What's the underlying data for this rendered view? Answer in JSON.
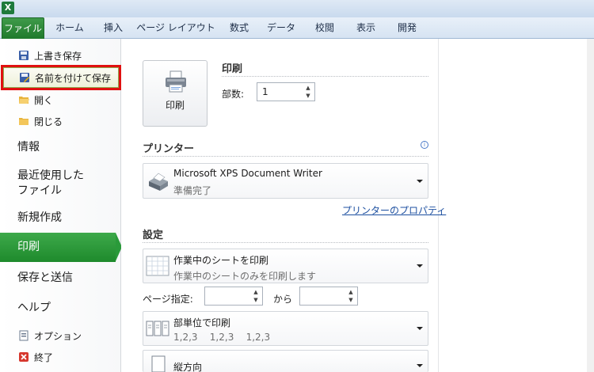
{
  "titlebar": {
    "app_icon": "excel-icon"
  },
  "ribbon": {
    "tabs": [
      {
        "label": "ファイル"
      },
      {
        "label": "ホーム"
      },
      {
        "label": "挿入"
      },
      {
        "label": "ページ レイアウト"
      },
      {
        "label": "数式"
      },
      {
        "label": "データ"
      },
      {
        "label": "校閲"
      },
      {
        "label": "表示"
      },
      {
        "label": "開発"
      }
    ]
  },
  "backstage": {
    "commands": [
      {
        "label": "上書き保存",
        "icon": "save-icon"
      },
      {
        "label": "名前を付けて保存",
        "icon": "save-as-icon"
      },
      {
        "label": "開く",
        "icon": "open-folder-icon"
      },
      {
        "label": "閉じる",
        "icon": "close-folder-icon"
      }
    ],
    "sections": [
      {
        "label": "情報"
      },
      {
        "label": "最近使用した\nファイル"
      },
      {
        "label": "新規作成"
      },
      {
        "label": "印刷"
      },
      {
        "label": "保存と送信"
      },
      {
        "label": "ヘルプ"
      }
    ],
    "bottom": [
      {
        "label": "オプション",
        "icon": "options-icon"
      },
      {
        "label": "終了",
        "icon": "exit-icon"
      }
    ]
  },
  "print": {
    "button_label": "印刷",
    "section_title": "印刷",
    "copies_label": "部数:",
    "copies_value": "1"
  },
  "printer": {
    "section_title": "プリンター",
    "name": "Microsoft XPS Document Writer",
    "status": "準備完了",
    "properties_link": "プリンターのプロパティ"
  },
  "settings": {
    "section_title": "設定",
    "scope_main": "作業中のシートを印刷",
    "scope_sub": "作業中のシートのみを印刷します",
    "pages_label": "ページ指定:",
    "pages_to_label": "から",
    "collate_main": "部単位で印刷",
    "collate_sub": "1,2,3    1,2,3    1,2,3",
    "orientation_main": "縦方向"
  },
  "colors": {
    "accent_green": "#2a9a3a",
    "highlight_red": "#e01010",
    "link_blue": "#1c4fa0"
  }
}
